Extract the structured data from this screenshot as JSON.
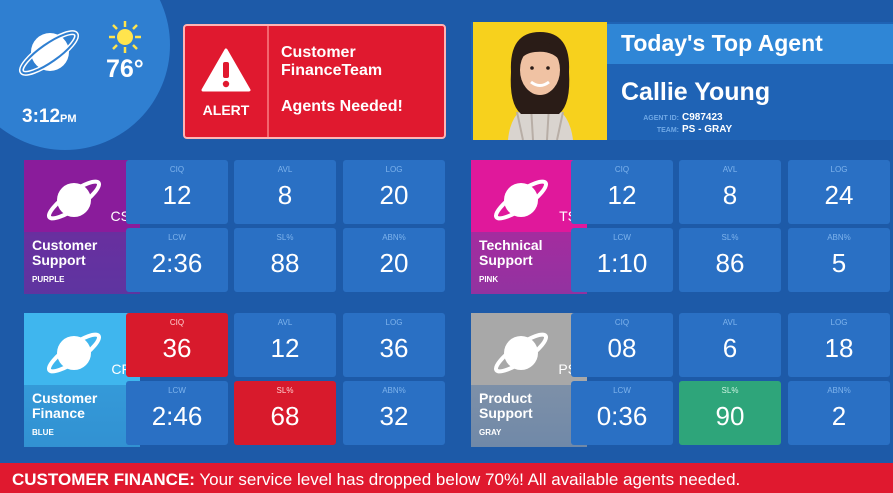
{
  "weather": {
    "temperature": "76°",
    "time": "3:12",
    "ampm": "PM",
    "icon": "sun-icon"
  },
  "alert": {
    "label": "ALERT",
    "team": "Customer FinanceTeam",
    "message": "Agents Needed!",
    "icon": "warning-icon"
  },
  "top_agent": {
    "title": "Today's Top Agent",
    "name": "Callie Young",
    "agent_id_label": "AGENT ID:",
    "agent_id": "C987423",
    "team_label": "TEAM:",
    "team": "PS - GRAY"
  },
  "teams": [
    {
      "abbr": "CS",
      "name_line1": "Customer",
      "name_line2": "Support",
      "color_name": "PURPLE",
      "color": "#8a1c9b",
      "metrics": [
        {
          "label": "CIQ",
          "value": "12"
        },
        {
          "label": "AVL",
          "value": "8"
        },
        {
          "label": "LOG",
          "value": "20"
        },
        {
          "label": "LCW",
          "value": "2:36"
        },
        {
          "label": "SL%",
          "value": "88"
        },
        {
          "label": "ABN%",
          "value": "20"
        }
      ]
    },
    {
      "abbr": "TS",
      "name_line1": "Technical",
      "name_line2": "Support",
      "color_name": "PINK",
      "color": "#e0189b",
      "metrics": [
        {
          "label": "CIQ",
          "value": "12"
        },
        {
          "label": "AVL",
          "value": "8"
        },
        {
          "label": "LOG",
          "value": "24"
        },
        {
          "label": "LCW",
          "value": "1:10"
        },
        {
          "label": "SL%",
          "value": "86"
        },
        {
          "label": "ABN%",
          "value": "5"
        }
      ]
    },
    {
      "abbr": "CF",
      "name_line1": "Customer",
      "name_line2": "Finance",
      "color_name": "BLUE",
      "color": "#3fb6ee",
      "metrics": [
        {
          "label": "CIQ",
          "value": "36",
          "status": "red"
        },
        {
          "label": "AVL",
          "value": "12"
        },
        {
          "label": "LOG",
          "value": "36"
        },
        {
          "label": "LCW",
          "value": "2:46"
        },
        {
          "label": "SL%",
          "value": "68",
          "status": "red"
        },
        {
          "label": "ABN%",
          "value": "32"
        }
      ]
    },
    {
      "abbr": "PS",
      "name_line1": "Product",
      "name_line2": "Support",
      "color_name": "GRAY",
      "color": "#a8a8a8",
      "metrics": [
        {
          "label": "CIQ",
          "value": "08"
        },
        {
          "label": "AVL",
          "value": "6"
        },
        {
          "label": "LOG",
          "value": "18"
        },
        {
          "label": "LCW",
          "value": "0:36"
        },
        {
          "label": "SL%",
          "value": "90",
          "status": "green"
        },
        {
          "label": "ABN%",
          "value": "2"
        }
      ]
    }
  ],
  "ticker": {
    "prefix": "CUSTOMER FINANCE:",
    "message": " Your service level has dropped below 70%! All available agents needed."
  }
}
